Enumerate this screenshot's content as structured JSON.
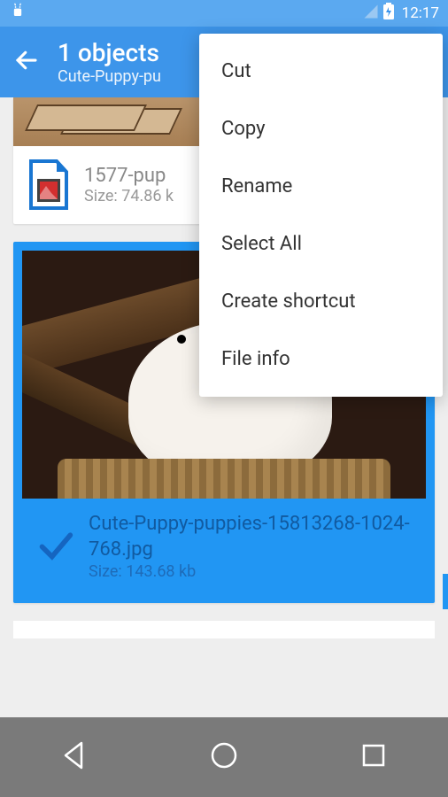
{
  "status": {
    "time": "12:17"
  },
  "app_bar": {
    "title": "1 objects",
    "subtitle": "Cute-Puppy-pu"
  },
  "file1": {
    "name": "1577-pup",
    "size": "Size: 74.86 k"
  },
  "file2": {
    "name": "Cute-Puppy-puppies-15813268-1024-768.jpg",
    "size": "Size: 143.68 kb"
  },
  "menu": {
    "cut": "Cut",
    "copy": "Copy",
    "rename": "Rename",
    "select_all": "Select All",
    "create_shortcut": "Create shortcut",
    "file_info": "File info"
  }
}
